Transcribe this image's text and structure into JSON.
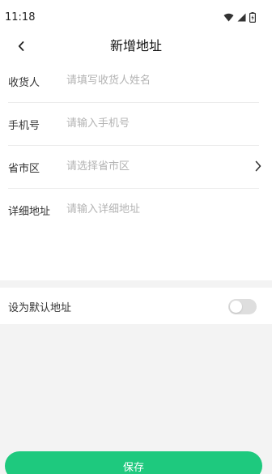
{
  "status_bar": {
    "time": "11:18",
    "icons": [
      "wifi-icon",
      "cellular-signal-icon",
      "battery-charging-icon"
    ]
  },
  "header": {
    "back_icon": "chevron-left-icon",
    "title": "新增地址"
  },
  "form": {
    "consignee": {
      "label": "收货人",
      "placeholder": "请填写收货人姓名",
      "value": ""
    },
    "phone": {
      "label": "手机号",
      "placeholder": "请输入手机号",
      "value": ""
    },
    "region": {
      "label": "省市区",
      "placeholder": "请选择省市区",
      "value": "",
      "icon": "chevron-right-icon"
    },
    "address": {
      "label": "详细地址",
      "placeholder": "请输入详细地址",
      "value": ""
    }
  },
  "default_address": {
    "label": "设为默认地址",
    "enabled": false
  },
  "save_button": {
    "label": "保存"
  },
  "colors": {
    "accent": "#1ec97e",
    "background": "#f3f3f3",
    "placeholder": "#b3b3b3",
    "toggle_off": "#dedede"
  }
}
